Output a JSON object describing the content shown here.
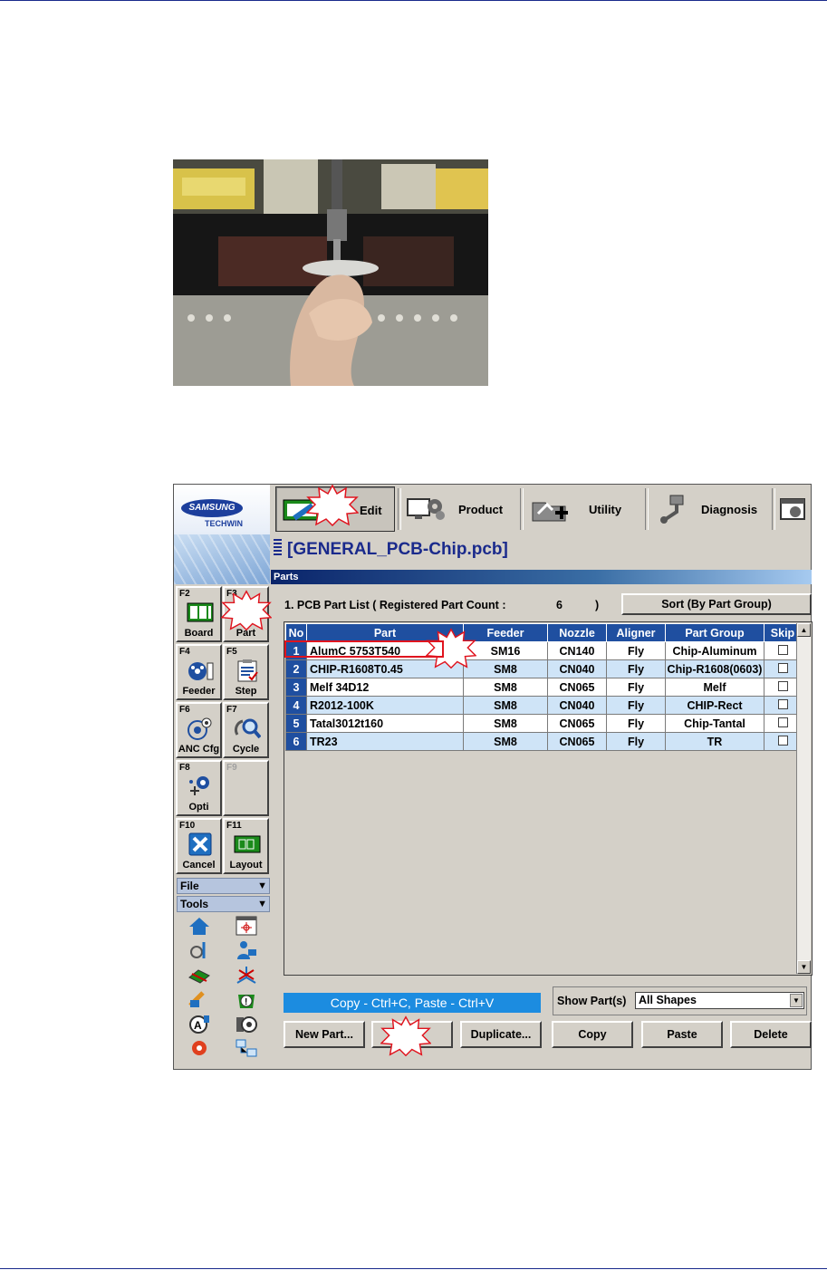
{
  "app": {
    "logo": {
      "brand": "SAMSUNG",
      "sub": "TECHWIN"
    },
    "toolbar": {
      "edit": "Edit",
      "product": "Product",
      "utility": "Utility",
      "diagnosis": "Diagnosis"
    },
    "file_title": "[GENERAL_PCB-Chip.pcb]",
    "section_header": "Parts",
    "part_list_label": "1. PCB Part List   ( Registered Part Count :",
    "part_count": "6",
    "part_count_close": ")",
    "sort_button": "Sort (By Part Group)",
    "fkeys": {
      "f2": {
        "key": "F2",
        "label": "Board"
      },
      "f3": {
        "key": "F3",
        "label": "Part"
      },
      "f4": {
        "key": "F4",
        "label": "Feeder"
      },
      "f5": {
        "key": "F5",
        "label": "Step"
      },
      "f6": {
        "key": "F6",
        "label": "ANC Cfg"
      },
      "f7": {
        "key": "F7",
        "label": "Cycle"
      },
      "f8": {
        "key": "F8",
        "label": "Opti"
      },
      "f9": {
        "key": "F9",
        "label": ""
      },
      "f10": {
        "key": "F10",
        "label": "Cancel"
      },
      "f11": {
        "key": "F11",
        "label": "Layout"
      }
    },
    "menus": {
      "file": "File",
      "tools": "Tools"
    },
    "table": {
      "headers": [
        "No",
        "Part",
        "Feeder",
        "Nozzle",
        "Aligner",
        "Part Group",
        "Skip"
      ],
      "rows": [
        {
          "no": "1",
          "part": "AlumC 5753T540",
          "feeder": "SM16",
          "nozzle": "CN140",
          "aligner": "Fly",
          "group": "Chip-Aluminum"
        },
        {
          "no": "2",
          "part": "CHIP-R1608T0.45",
          "feeder": "SM8",
          "nozzle": "CN040",
          "aligner": "Fly",
          "group": "Chip-R1608(0603)"
        },
        {
          "no": "3",
          "part": "Melf 34D12",
          "feeder": "SM8",
          "nozzle": "CN065",
          "aligner": "Fly",
          "group": "Melf"
        },
        {
          "no": "4",
          "part": "R2012-100K",
          "feeder": "SM8",
          "nozzle": "CN040",
          "aligner": "Fly",
          "group": "CHIP-Rect"
        },
        {
          "no": "5",
          "part": "Tatal3012t160",
          "feeder": "SM8",
          "nozzle": "CN065",
          "aligner": "Fly",
          "group": "Chip-Tantal"
        },
        {
          "no": "6",
          "part": "TR23",
          "feeder": "SM8",
          "nozzle": "CN065",
          "aligner": "Fly",
          "group": "TR"
        }
      ]
    },
    "copy_hint": "Copy - Ctrl+C,  Paste - Ctrl+V",
    "show_parts_label": "Show Part(s)",
    "show_parts_value": "All Shapes",
    "buttons": {
      "new_part": "New Part...",
      "edit": "",
      "duplicate": "Duplicate...",
      "copy": "Copy",
      "paste": "Paste",
      "delete": "Delete"
    }
  },
  "colors": {
    "accent": "#1f4fa0",
    "row_alt": "#cfe4f7",
    "callout": "#e0141e",
    "hint_bg": "#1c8ce0"
  }
}
